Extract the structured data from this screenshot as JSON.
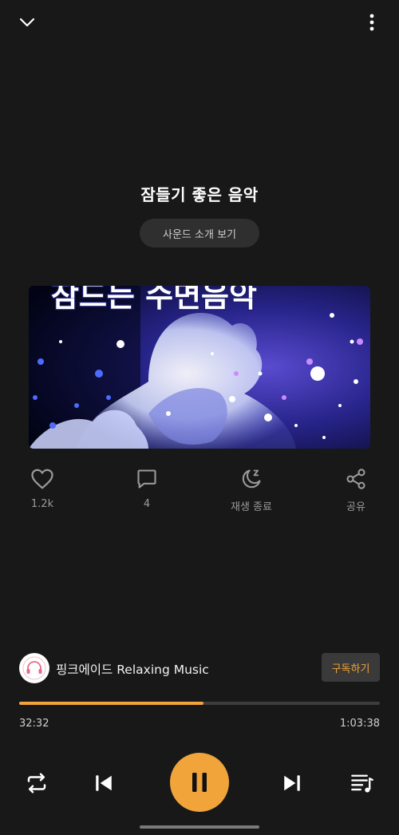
{
  "header": {
    "collapse_icon": "chevron-down-icon",
    "menu_icon": "more-vertical-icon"
  },
  "track": {
    "title": "잠들기 좋은 음악",
    "intro_button": "사운드 소개 보기",
    "artwork_text": "잠드는 수면음악"
  },
  "actions": [
    {
      "icon": "heart-icon",
      "label": "1.2k"
    },
    {
      "icon": "comment-icon",
      "label": "4"
    },
    {
      "icon": "sleep-timer-icon",
      "label": "재생 종료"
    },
    {
      "icon": "share-icon",
      "label": "공유"
    }
  ],
  "channel": {
    "name": "핑크에이드 Relaxing Music",
    "subscribe_label": "구독하기"
  },
  "playback": {
    "current_time": "32:32",
    "total_time": "1:03:38",
    "progress_fraction": 0.512
  },
  "controls": {
    "repeat_icon": "repeat-icon",
    "prev_icon": "skip-previous-icon",
    "pause_icon": "pause-icon",
    "next_icon": "skip-next-icon",
    "queue_icon": "queue-music-icon"
  },
  "colors": {
    "background": "#181818",
    "accent": "#f0a43a",
    "muted_text": "#9a9a9a"
  }
}
